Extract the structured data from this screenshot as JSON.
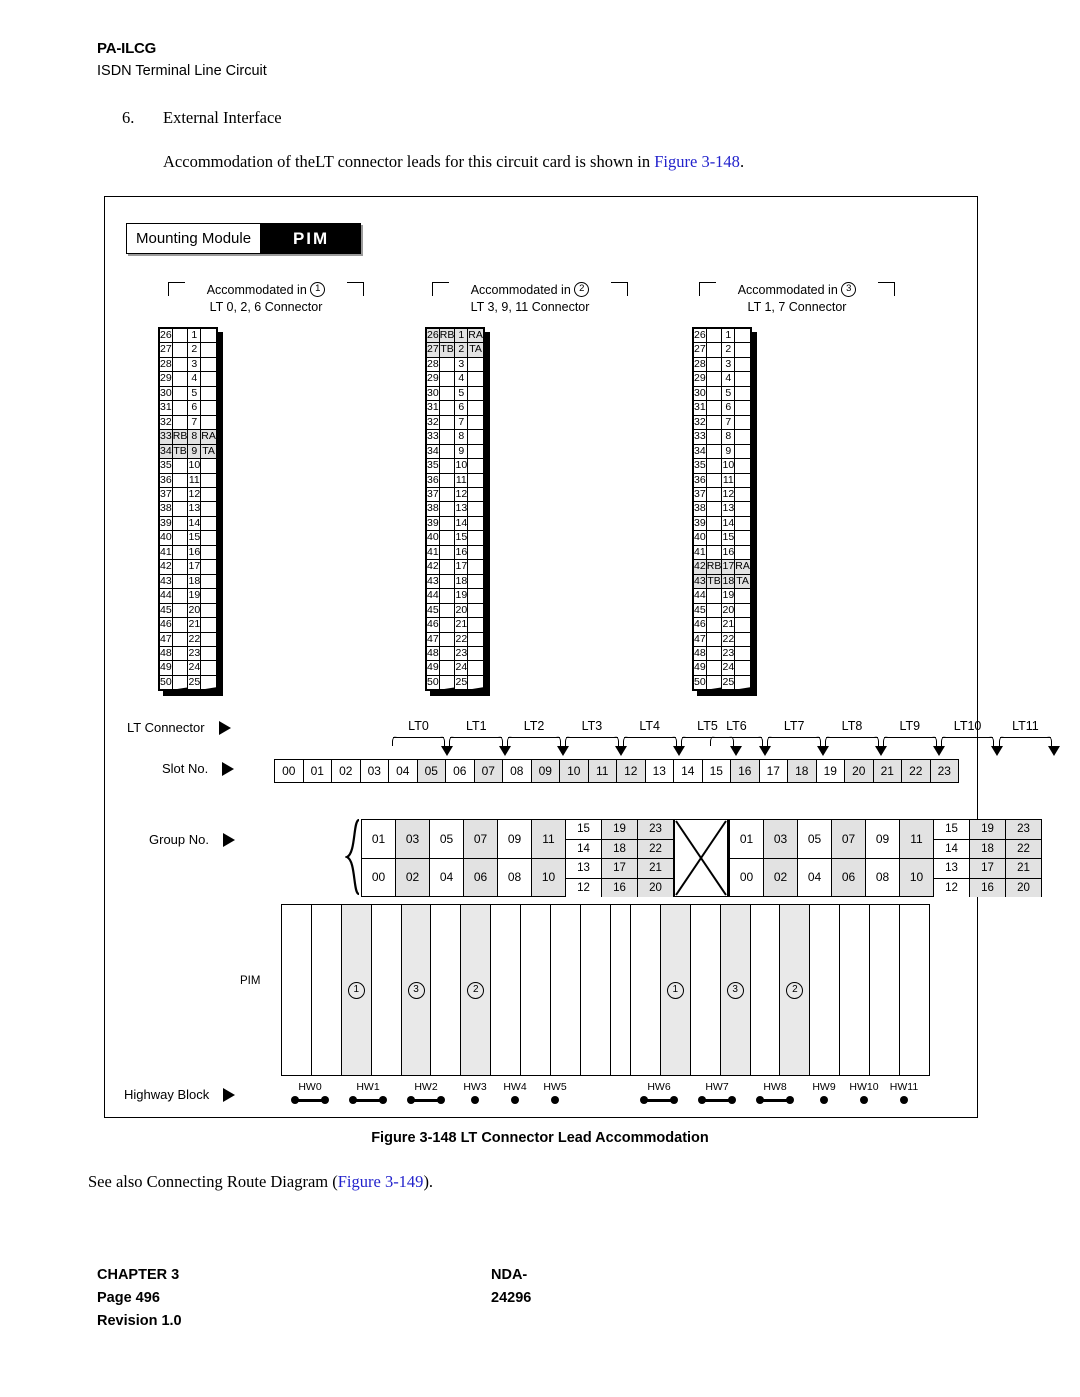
{
  "header": {
    "product_code": "PA-ILCG",
    "subtitle": "ISDN Terminal Line Circuit",
    "section_number": "6.",
    "section_title": "External Interface",
    "intro_before": "Accommodation of the",
    "intro_mid": "LT connector leads for this circuit card is shown in ",
    "intro_link": "Figure 3-148",
    "intro_after": "."
  },
  "figure": {
    "mounting_module_label": "Mounting Module",
    "mounting_module_value": "PIM",
    "caption": "Figure 3-148   LT Connector Lead Accommodation",
    "see_also_before": "See also Connecting Route Diagram (",
    "see_also_link": "Figure 3-149",
    "see_also_after": ").",
    "row_labels": {
      "lt_connector": "LT Connector",
      "slot_no": "Slot No.",
      "group_no": "Group No.",
      "pim": "PIM",
      "highway_block": "Highway Block"
    },
    "connectors": [
      {
        "accommodated_in": "Accommodated in",
        "circle": "1",
        "connector_label": "LT 0, 2, 6 Connector",
        "left_pins": [
          "26",
          "27",
          "28",
          "29",
          "30",
          "31",
          "32",
          "33",
          "34",
          "35",
          "36",
          "37",
          "38",
          "39",
          "40",
          "41",
          "42",
          "43",
          "44",
          "45",
          "46",
          "47",
          "48",
          "49",
          "50"
        ],
        "right_pins": [
          "1",
          "2",
          "3",
          "4",
          "5",
          "6",
          "7",
          "8",
          "9",
          "10",
          "11",
          "12",
          "13",
          "14",
          "15",
          "16",
          "17",
          "18",
          "19",
          "20",
          "21",
          "22",
          "23",
          "24",
          "25"
        ],
        "leads": [
          {
            "row_index": 7,
            "left_value": "RB",
            "right_value": "RA"
          },
          {
            "row_index": 8,
            "left_value": "TB",
            "right_value": "TA"
          }
        ]
      },
      {
        "accommodated_in": "Accommodated in",
        "circle": "2",
        "connector_label": "LT 3, 9, 11 Connector",
        "left_pins": [
          "26",
          "27",
          "28",
          "29",
          "30",
          "31",
          "32",
          "33",
          "34",
          "35",
          "36",
          "37",
          "38",
          "39",
          "40",
          "41",
          "42",
          "43",
          "44",
          "45",
          "46",
          "47",
          "48",
          "49",
          "50"
        ],
        "right_pins": [
          "1",
          "2",
          "3",
          "4",
          "5",
          "6",
          "7",
          "8",
          "9",
          "10",
          "11",
          "12",
          "13",
          "14",
          "15",
          "16",
          "17",
          "18",
          "19",
          "20",
          "21",
          "22",
          "23",
          "24",
          "25"
        ],
        "leads": [
          {
            "row_index": 0,
            "left_value": "RB",
            "right_value": "RA"
          },
          {
            "row_index": 1,
            "left_value": "TB",
            "right_value": "TA"
          }
        ]
      },
      {
        "accommodated_in": "Accommodated in",
        "circle": "3",
        "connector_label": "LT 1, 7 Connector",
        "left_pins": [
          "26",
          "27",
          "28",
          "29",
          "30",
          "31",
          "32",
          "33",
          "34",
          "35",
          "36",
          "37",
          "38",
          "39",
          "40",
          "41",
          "42",
          "43",
          "44",
          "45",
          "46",
          "47",
          "48",
          "49",
          "50"
        ],
        "right_pins": [
          "1",
          "2",
          "3",
          "4",
          "5",
          "6",
          "7",
          "8",
          "9",
          "10",
          "11",
          "12",
          "13",
          "14",
          "15",
          "16",
          "17",
          "18",
          "19",
          "20",
          "21",
          "22",
          "23",
          "24",
          "25"
        ],
        "leads": [
          {
            "row_index": 16,
            "left_value": "RB",
            "right_value": "RA"
          },
          {
            "row_index": 17,
            "left_value": "TB",
            "right_value": "TA"
          }
        ]
      }
    ],
    "lt_connector_names_left": [
      "LT0",
      "LT1",
      "LT2",
      "LT3",
      "LT4",
      "LT5"
    ],
    "lt_connector_names_right": [
      "LT6",
      "LT7",
      "LT8",
      "LT9",
      "LT10",
      "LT11"
    ],
    "slot_numbers": [
      "00",
      "01",
      "02",
      "03",
      "04",
      "05",
      "06",
      "07",
      "08",
      "09",
      "10",
      "11",
      "12",
      "13",
      "14",
      "15",
      "16",
      "17",
      "18",
      "19",
      "20",
      "21",
      "22",
      "23"
    ],
    "slot_shaded": [
      false,
      false,
      false,
      false,
      false,
      true,
      false,
      true,
      false,
      true,
      true,
      true,
      true,
      false,
      false,
      false,
      true,
      false,
      true,
      false,
      true,
      true,
      true,
      true
    ],
    "group_block_left": {
      "pair_columns": [
        {
          "top": "01",
          "bottom": "00",
          "shaded": false
        },
        {
          "top": "03",
          "bottom": "02",
          "shaded": true
        },
        {
          "top": "05",
          "bottom": "04",
          "shaded": false
        },
        {
          "top": "07",
          "bottom": "06",
          "shaded": true
        },
        {
          "top": "09",
          "bottom": "08",
          "shaded": false
        },
        {
          "top": "11",
          "bottom": "10",
          "shaded": true
        }
      ],
      "quad_columns": [
        {
          "values": [
            "15",
            "14",
            "13",
            "12"
          ],
          "shaded": false
        },
        {
          "values": [
            "19",
            "18",
            "17",
            "16"
          ],
          "shaded": true
        },
        {
          "values": [
            "23",
            "22",
            "21",
            "20"
          ],
          "shaded": true
        }
      ]
    },
    "group_block_right": {
      "pair_columns": [
        {
          "top": "01",
          "bottom": "00",
          "shaded": false
        },
        {
          "top": "03",
          "bottom": "02",
          "shaded": true
        },
        {
          "top": "05",
          "bottom": "04",
          "shaded": false
        },
        {
          "top": "07",
          "bottom": "06",
          "shaded": true
        },
        {
          "top": "09",
          "bottom": "08",
          "shaded": false
        },
        {
          "top": "11",
          "bottom": "10",
          "shaded": true
        }
      ],
      "quad_columns": [
        {
          "values": [
            "15",
            "14",
            "13",
            "12"
          ],
          "shaded": false
        },
        {
          "values": [
            "19",
            "18",
            "17",
            "16"
          ],
          "shaded": true
        },
        {
          "values": [
            "23",
            "22",
            "21",
            "20"
          ],
          "shaded": true
        }
      ]
    },
    "pim_slots_left": [
      {
        "marker": "",
        "shaded": false
      },
      {
        "marker": "",
        "shaded": false
      },
      {
        "marker": "1",
        "shaded": true
      },
      {
        "marker": "",
        "shaded": false
      },
      {
        "marker": "3",
        "shaded": true
      },
      {
        "marker": "",
        "shaded": false
      },
      {
        "marker": "2",
        "shaded": true
      },
      {
        "marker": "",
        "shaded": false
      },
      {
        "marker": "",
        "shaded": false
      },
      {
        "marker": "",
        "shaded": false
      },
      {
        "marker": "",
        "shaded": false
      },
      {
        "marker": "",
        "shaded": false
      }
    ],
    "pim_slots_right": [
      {
        "marker": "",
        "shaded": false
      },
      {
        "marker": "1",
        "shaded": true
      },
      {
        "marker": "",
        "shaded": false
      },
      {
        "marker": "3",
        "shaded": true
      },
      {
        "marker": "",
        "shaded": false
      },
      {
        "marker": "2",
        "shaded": true
      },
      {
        "marker": "",
        "shaded": false
      },
      {
        "marker": "",
        "shaded": false
      },
      {
        "marker": "",
        "shaded": false
      },
      {
        "marker": "",
        "shaded": false
      }
    ],
    "highway_blocks_left": [
      {
        "label": "HW0",
        "paired": true
      },
      {
        "label": "HW1",
        "paired": true
      },
      {
        "label": "HW2",
        "paired": true
      },
      {
        "label": "HW3",
        "paired": false
      },
      {
        "label": "HW4",
        "paired": false
      },
      {
        "label": "HW5",
        "paired": false
      }
    ],
    "highway_blocks_right": [
      {
        "label": "HW6",
        "paired": true
      },
      {
        "label": "HW7",
        "paired": true
      },
      {
        "label": "HW8",
        "paired": true
      },
      {
        "label": "HW9",
        "paired": false
      },
      {
        "label": "HW10",
        "paired": false
      },
      {
        "label": "HW11",
        "paired": false
      }
    ]
  },
  "footer": {
    "chapter": "CHAPTER 3",
    "page": "Page 496",
    "revision": "Revision 1.0",
    "document": "NDA-24296"
  }
}
